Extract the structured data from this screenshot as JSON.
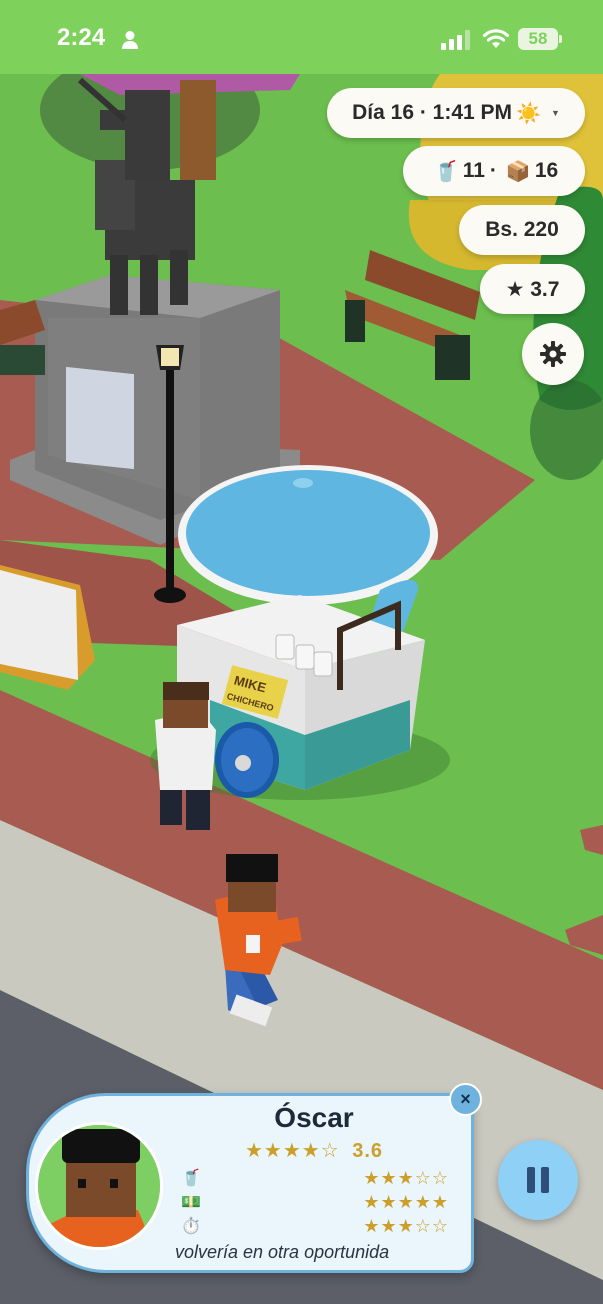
{
  "status_bar": {
    "time": "2:24",
    "battery": "58",
    "icons": [
      "person-icon",
      "cellular-signal-icon",
      "wifi-icon",
      "battery-icon"
    ]
  },
  "hud": {
    "day_label": "Día 16 · 1:41 PM",
    "weather_icon": "☀️",
    "drinks_icon": "🥤",
    "drinks_count": "11",
    "separator": "·",
    "boxes_icon": "📦",
    "boxes_count": "16",
    "money": "Bs. 220",
    "rating": "★ 3.7",
    "settings_icon": "gear-icon"
  },
  "scene": {
    "cart_logo_line1": "MIKE",
    "cart_logo_line2": "CHICHERO"
  },
  "customer_card": {
    "name": "Óscar",
    "stars": "★★★★☆",
    "score": "3.6",
    "rows": [
      {
        "icon": "🥤",
        "stars": "★★★☆☆"
      },
      {
        "icon": "💵",
        "stars": "★★★★★"
      },
      {
        "icon": "⏱️",
        "stars": "★★★☆☆"
      }
    ],
    "comment": "volvería en otra oportunida",
    "close_label": "×"
  },
  "colors": {
    "grass": "#6cbf4e",
    "status_bar": "#7ed15b",
    "brick_path": "#a85b50",
    "sidewalk": "#c9c9c0",
    "road": "#5c5f68",
    "accent_blue": "#8ed0f6",
    "star_gold": "#caa02a"
  }
}
